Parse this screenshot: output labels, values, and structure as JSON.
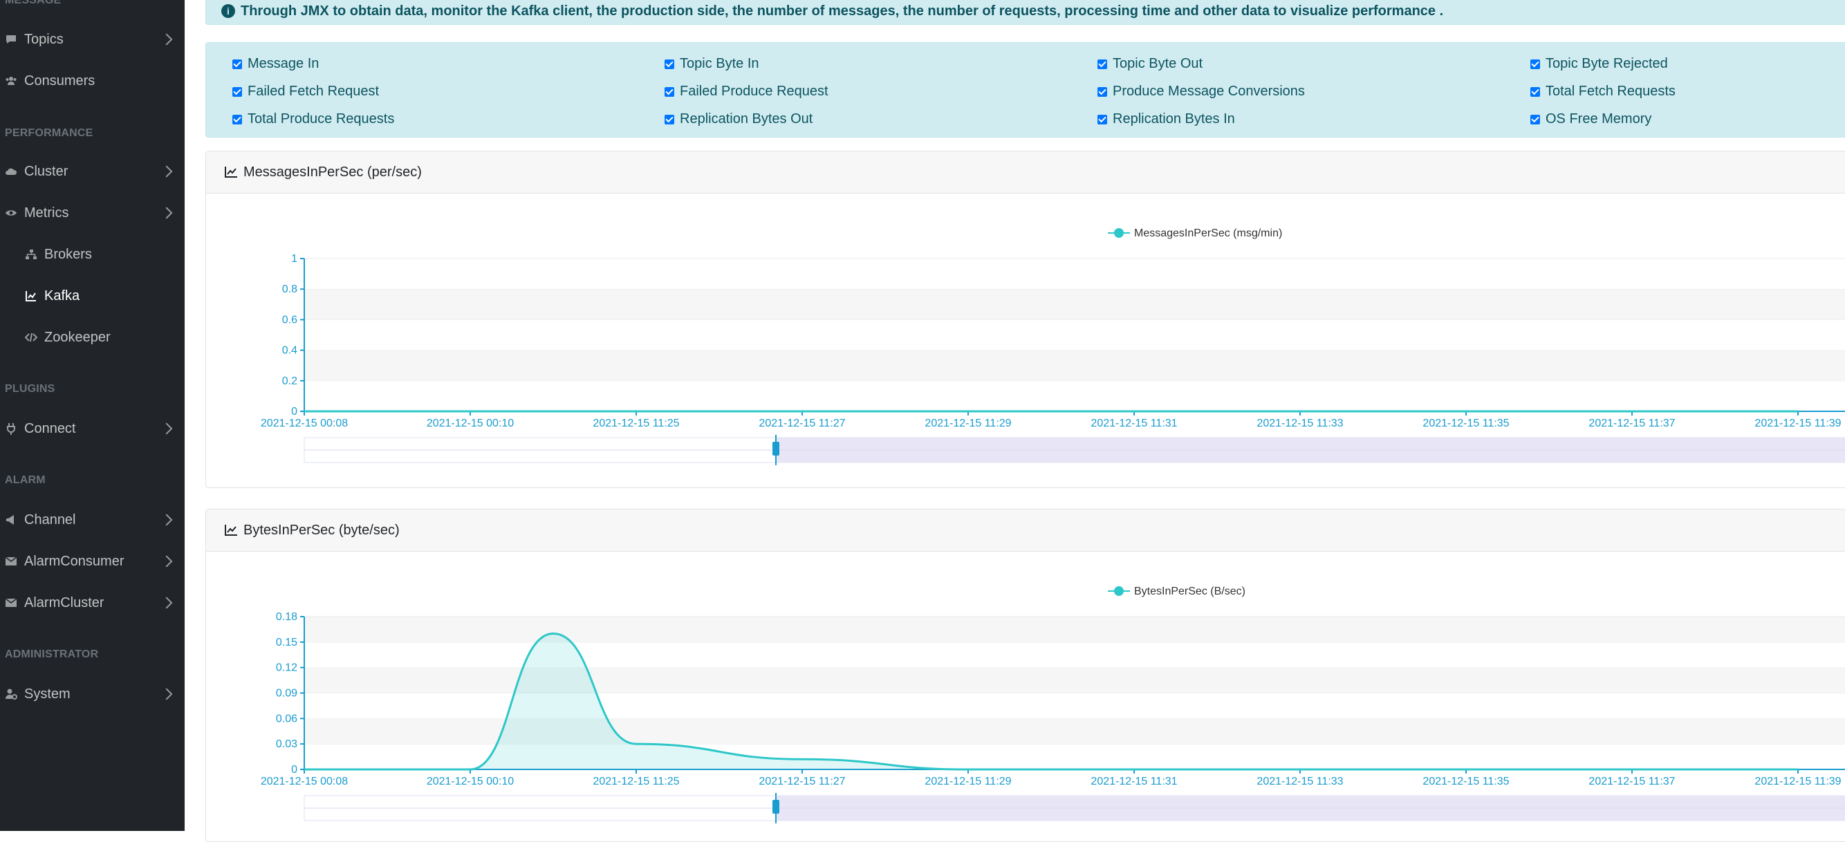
{
  "sidebar": {
    "headings": {
      "message": "MESSAGE",
      "performance": "PERFORMANCE",
      "plugins": "PLUGINS",
      "alarm": "ALARM",
      "administrator": "ADMINISTRATOR"
    },
    "items": {
      "topics": "Topics",
      "consumers": "Consumers",
      "cluster": "Cluster",
      "metrics": "Metrics",
      "brokers": "Brokers",
      "kafka": "Kafka",
      "zookeeper": "Zookeeper",
      "connect": "Connect",
      "channel": "Channel",
      "alarm_consumer": "AlarmConsumer",
      "alarm_cluster": "AlarmCluster",
      "system": "System"
    }
  },
  "alert": {
    "text": "Through JMX to obtain data, monitor the Kafka client, the production side, the number of messages, the number of requests, processing time and other data to visualize performance ."
  },
  "checkboxes": [
    {
      "label": "Message In",
      "checked": true
    },
    {
      "label": "Topic Byte In",
      "checked": true
    },
    {
      "label": "Topic Byte Out",
      "checked": true
    },
    {
      "label": "Topic Byte Rejected",
      "checked": true
    },
    {
      "label": "Failed Fetch Request",
      "checked": true
    },
    {
      "label": "Failed Produce Request",
      "checked": true
    },
    {
      "label": "Produce Message Conversions",
      "checked": true
    },
    {
      "label": "Total Fetch Requests",
      "checked": true
    },
    {
      "label": "Total Produce Requests",
      "checked": true
    },
    {
      "label": "Replication Bytes Out",
      "checked": true
    },
    {
      "label": "Replication Bytes In",
      "checked": true
    },
    {
      "label": "OS Free Memory",
      "checked": true
    }
  ],
  "panels": [
    {
      "title": "MessagesInPerSec (per/sec)",
      "legend": "MessagesInPerSec (msg/min)"
    },
    {
      "title": "BytesInPerSec (byte/sec)",
      "legend": "BytesInPerSec (B/sec)"
    }
  ],
  "colors": {
    "sidebar_bg": "#212529",
    "series": "#2ec7c9",
    "axis": "#1a9ccf",
    "alert_bg": "#d1ecf1",
    "alert_text": "#0c5460"
  },
  "chart_data": [
    {
      "type": "line",
      "title": "",
      "legend": [
        "MessagesInPerSec (msg/min)"
      ],
      "x": [
        "2021-12-15 00:08",
        "2021-12-15 00:10",
        "2021-12-15 11:25",
        "2021-12-15 11:27",
        "2021-12-15 11:29",
        "2021-12-15 11:31",
        "2021-12-15 11:33",
        "2021-12-15 11:35",
        "2021-12-15 11:37",
        "2021-12-15 11:39"
      ],
      "series": [
        {
          "name": "MessagesInPerSec (msg/min)",
          "values": [
            0,
            0,
            0,
            0,
            0,
            0,
            0,
            0,
            0,
            0
          ]
        }
      ],
      "y_ticks": [
        "0",
        "0.2",
        "0.4",
        "0.6",
        "0.8",
        "1"
      ],
      "ylim": [
        0,
        1
      ],
      "grid": true
    },
    {
      "type": "area",
      "title": "",
      "legend": [
        "BytesInPerSec (B/sec)"
      ],
      "x": [
        "2021-12-15 00:08",
        "2021-12-15 00:10",
        "2021-12-15 11:25",
        "2021-12-15 11:27",
        "2021-12-15 11:29",
        "2021-12-15 11:31",
        "2021-12-15 11:33",
        "2021-12-15 11:35",
        "2021-12-15 11:37",
        "2021-12-15 11:39"
      ],
      "series": [
        {
          "name": "BytesInPerSec (B/sec)",
          "values": [
            0,
            0,
            0.03,
            0.012,
            0,
            0,
            0,
            0,
            0,
            0
          ]
        }
      ],
      "peak": {
        "x_between": [
          "2021-12-15 00:10",
          "2021-12-15 11:25"
        ],
        "value": 0.16
      },
      "y_ticks": [
        "0",
        "0.03",
        "0.06",
        "0.09",
        "0.12",
        "0.15",
        "0.18"
      ],
      "ylim": [
        0,
        0.18
      ],
      "grid": true
    }
  ]
}
